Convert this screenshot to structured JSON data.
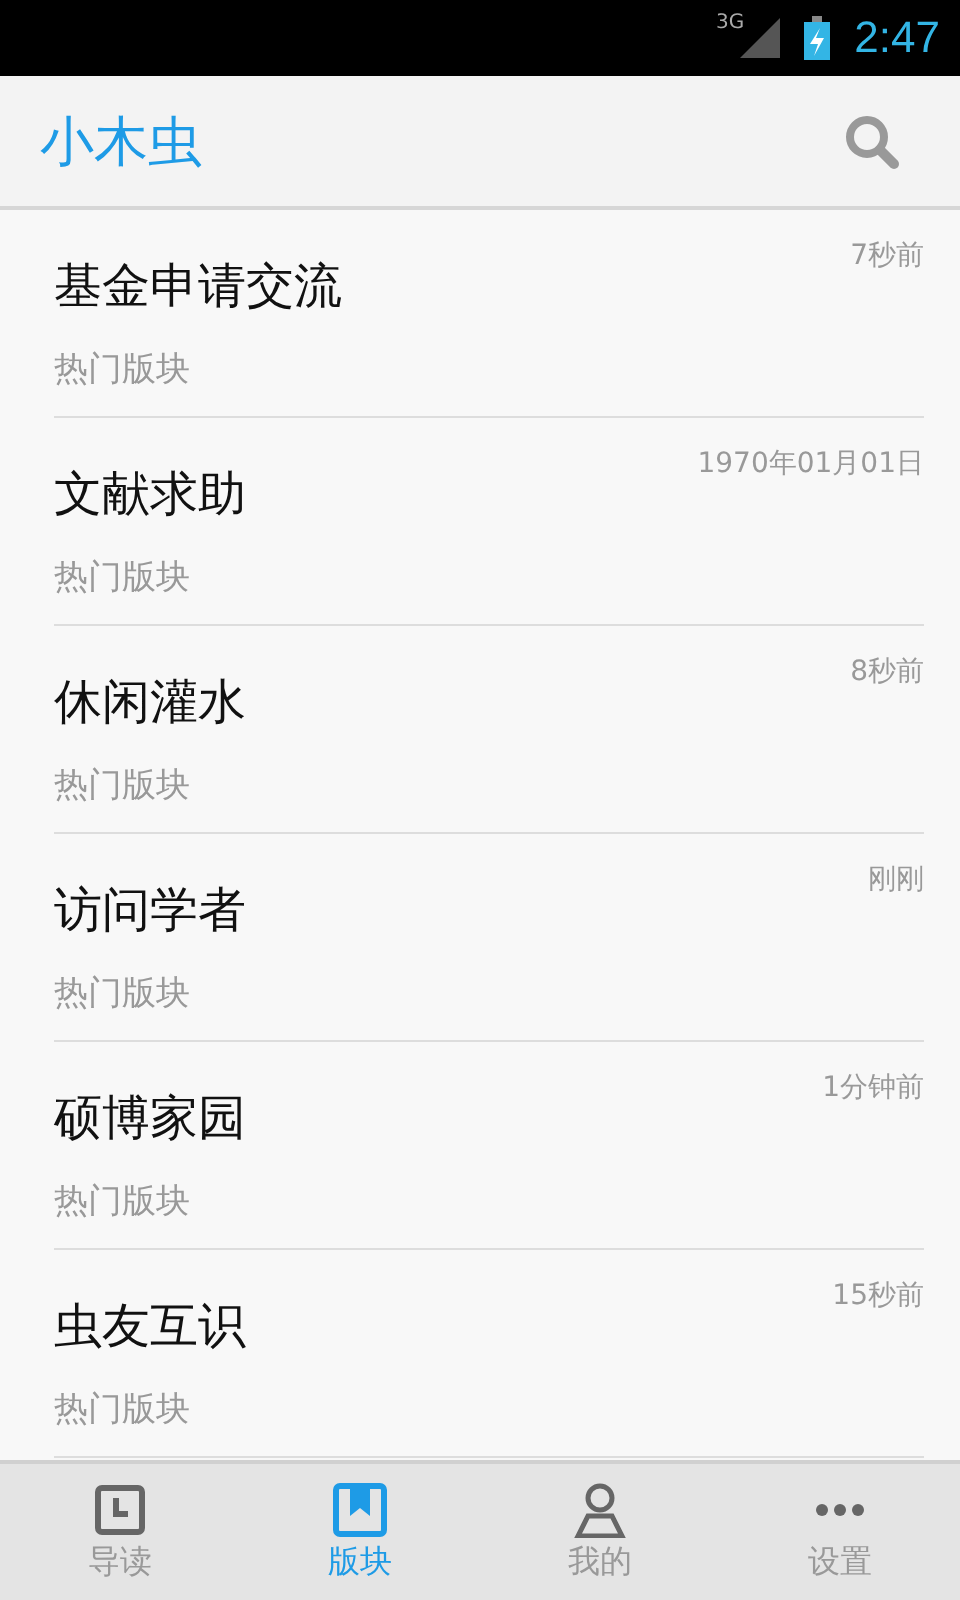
{
  "status_bar": {
    "network": "3G",
    "time": "2:47"
  },
  "app_bar": {
    "title": "小木虫"
  },
  "items": [
    {
      "title": "基金申请交流",
      "subtitle": "热门版块",
      "time": "7秒前"
    },
    {
      "title": "文献求助",
      "subtitle": "热门版块",
      "time": "1970年01月01日"
    },
    {
      "title": "休闲灌水",
      "subtitle": "热门版块",
      "time": "8秒前"
    },
    {
      "title": "访问学者",
      "subtitle": "热门版块",
      "time": "刚刚"
    },
    {
      "title": "硕博家园",
      "subtitle": "热门版块",
      "time": "1分钟前"
    },
    {
      "title": "虫友互识",
      "subtitle": "热门版块",
      "time": "15秒前"
    }
  ],
  "tabs": [
    {
      "label": "导读",
      "kind": "clock",
      "selected": false
    },
    {
      "label": "版块",
      "kind": "bookmark",
      "selected": true
    },
    {
      "label": "我的",
      "kind": "person",
      "selected": false
    },
    {
      "label": "设置",
      "kind": "more",
      "selected": false
    }
  ]
}
